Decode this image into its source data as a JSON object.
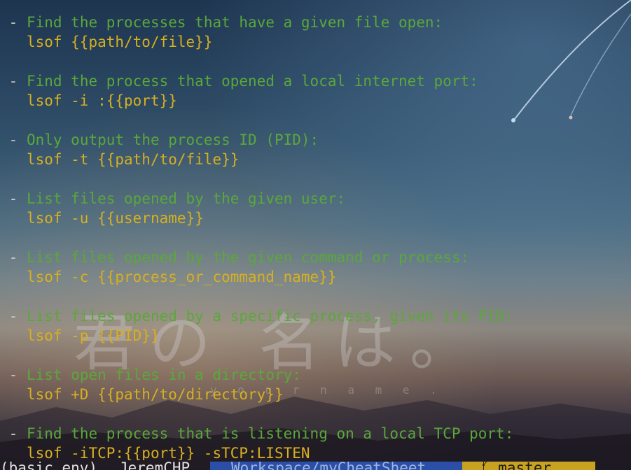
{
  "terminal": {
    "entries": [
      {
        "description": "Find the processes that have a given file open:",
        "command": "lsof {{path/to/file}}"
      },
      {
        "description": "Find the process that opened a local internet port:",
        "command": "lsof -i :{{port}}"
      },
      {
        "description": "Only output the process ID (PID):",
        "command": "lsof -t {{path/to/file}}"
      },
      {
        "description": "List files opened by the given user:",
        "command": "lsof -u {{username}}"
      },
      {
        "description": "List files opened by the given command or process:",
        "command": "lsof -c {{process_or_command_name}}"
      },
      {
        "description": "List files opened by a specific process, given its PID:",
        "command": "lsof -p {{PID}}"
      },
      {
        "description": "List open files in a directory:",
        "command": "lsof +D {{path/to/directory}}"
      },
      {
        "description": "Find the process that is listening on a local TCP port:",
        "command": "lsof -iTCP:{{port}} -sTCP:LISTEN"
      }
    ],
    "bullet": "-"
  },
  "prompt": {
    "env": "(basic_env)",
    "user": "JeremCHP",
    "path": "Workspace/myCheatSheet",
    "git_branch": "master",
    "git_icon": "branch-icon"
  },
  "background": {
    "watermark": "君の 名は。",
    "watermark_sub": "y o u r n a m e ."
  },
  "colors": {
    "description": "#5aa83a",
    "command": "#d6b020",
    "bullet": "#c9c9c9",
    "path_segment": "#2b4fa8",
    "git_segment": "#c9a21f"
  }
}
